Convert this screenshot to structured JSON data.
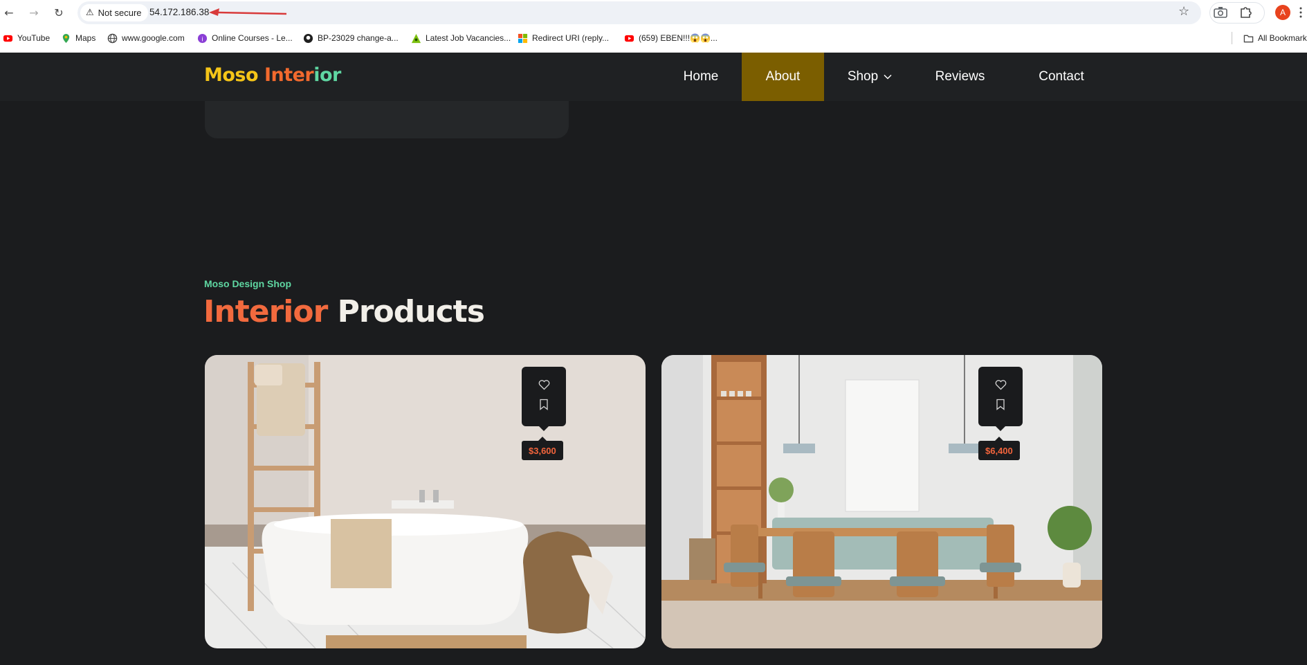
{
  "browser": {
    "security_label": "Not secure",
    "url": "54.172.186.38",
    "avatar_letter": "A",
    "bookmarks": [
      {
        "label": "YouTube",
        "icon": "youtube-icon"
      },
      {
        "label": "Maps",
        "icon": "maps-icon"
      },
      {
        "label": "www.google.com",
        "icon": "globe-icon"
      },
      {
        "label": "Online Courses - Le...",
        "icon": "courses-icon"
      },
      {
        "label": "BP-23029 change-a...",
        "icon": "github-icon"
      },
      {
        "label": "Latest Job Vacancies...",
        "icon": "jobs-icon"
      },
      {
        "label": "Redirect URI (reply...",
        "icon": "microsoft-icon"
      },
      {
        "label": "(659) EBEN!!!😱😱...",
        "icon": "youtube-icon"
      }
    ],
    "all_bookmarks_label": "All Bookmarks"
  },
  "site": {
    "logo": {
      "part1": "Moso",
      "part2": " Inter",
      "part3": "ior"
    },
    "nav": [
      {
        "label": "Home"
      },
      {
        "label": "About"
      },
      {
        "label": "Shop"
      },
      {
        "label": "Reviews"
      },
      {
        "label": "Contact"
      }
    ],
    "active_nav": "About",
    "section": {
      "eyebrow": "Moso Design Shop",
      "title_accent": "Interior",
      "title_rest": " Products"
    },
    "products": [
      {
        "price": "$3,600",
        "image": "bathroom-tub-photo"
      },
      {
        "price": "$6,400",
        "image": "dining-room-photo"
      }
    ]
  },
  "colors": {
    "page_bg": "#1b1c1e",
    "header_bg": "#1f2123",
    "active_nav_bg": "#7b5e00",
    "accent_orange": "#f26a3e",
    "accent_green": "#5fd7a2",
    "accent_yellow": "#f5c518",
    "price_text": "#f2643c"
  }
}
